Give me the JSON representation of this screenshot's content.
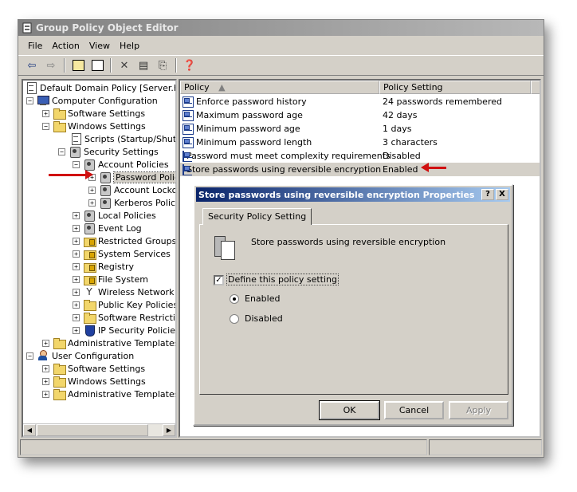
{
  "window": {
    "title": "Group Policy Object Editor"
  },
  "menu": [
    "File",
    "Action",
    "View",
    "Help"
  ],
  "toolbar": {
    "icons": [
      "back-arrow-icon",
      "forward-arrow-icon",
      "up-folder-icon",
      "show-hide-tree-icon",
      "delete-icon",
      "properties-icon",
      "export-list-icon",
      "help-icon"
    ]
  },
  "tree": {
    "items": [
      {
        "label": "Default Domain Policy [Server.hal.l",
        "icon": "policy-doc-icon"
      },
      {
        "label": "Computer Configuration",
        "icon": "computer-icon"
      },
      {
        "label": "Software Settings",
        "icon": "folder-icon"
      },
      {
        "label": "Windows Settings",
        "icon": "folder-icon"
      },
      {
        "label": "Scripts (Startup/Shutdo",
        "icon": "script-icon"
      },
      {
        "label": "Security Settings",
        "icon": "security-icon"
      },
      {
        "label": "Account Policies",
        "icon": "gear-icon"
      },
      {
        "label": "Password Polic",
        "icon": "gear-icon"
      },
      {
        "label": "Account Lockou",
        "icon": "gear-icon"
      },
      {
        "label": "Kerberos Policy",
        "icon": "gear-icon"
      },
      {
        "label": "Local Policies",
        "icon": "gear-icon"
      },
      {
        "label": "Event Log",
        "icon": "gear-icon"
      },
      {
        "label": "Restricted Groups",
        "icon": "lock-folder-icon"
      },
      {
        "label": "System Services",
        "icon": "lock-folder-icon"
      },
      {
        "label": "Registry",
        "icon": "lock-folder-icon"
      },
      {
        "label": "File System",
        "icon": "lock-folder-icon"
      },
      {
        "label": "Wireless Network (",
        "icon": "antenna-icon"
      },
      {
        "label": "Public Key Policies",
        "icon": "folder-icon"
      },
      {
        "label": "Software Restrictic",
        "icon": "folder-icon"
      },
      {
        "label": "IP Security Policies",
        "icon": "shield-icon"
      },
      {
        "label": "Administrative Templates",
        "icon": "folder-icon"
      },
      {
        "label": "User Configuration",
        "icon": "user-icon"
      },
      {
        "label": "Software Settings",
        "icon": "folder-icon"
      },
      {
        "label": "Windows Settings",
        "icon": "folder-icon"
      },
      {
        "label": "Administrative Templates",
        "icon": "folder-icon"
      }
    ]
  },
  "list": {
    "columns": [
      "Policy",
      "Policy Setting"
    ],
    "rows": [
      {
        "policy": "Enforce password history",
        "setting": "24 passwords remembered"
      },
      {
        "policy": "Maximum password age",
        "setting": "42 days"
      },
      {
        "policy": "Minimum password age",
        "setting": "1 days"
      },
      {
        "policy": "Minimum password length",
        "setting": "3 characters"
      },
      {
        "policy": "Password must meet complexity requirements",
        "setting": "Disabled"
      },
      {
        "policy": "Store passwords using reversible encryption",
        "setting": "Enabled"
      }
    ]
  },
  "dialog": {
    "title": "Store passwords using reversible encryption Properties",
    "help_label": "?",
    "close_label": "X",
    "tab": "Security Policy Setting",
    "description": "Store passwords using reversible encryption",
    "define_checkbox": "Define this policy setting",
    "define_checked": true,
    "options": [
      {
        "label": "Enabled",
        "selected": true
      },
      {
        "label": "Disabled",
        "selected": false
      }
    ],
    "buttons": {
      "ok": "OK",
      "cancel": "Cancel",
      "apply": "Apply"
    }
  },
  "colors": {
    "annotation_arrow": "#d01010",
    "dialog_title_start": "#0a246a",
    "dialog_title_end": "#a6caf0"
  }
}
